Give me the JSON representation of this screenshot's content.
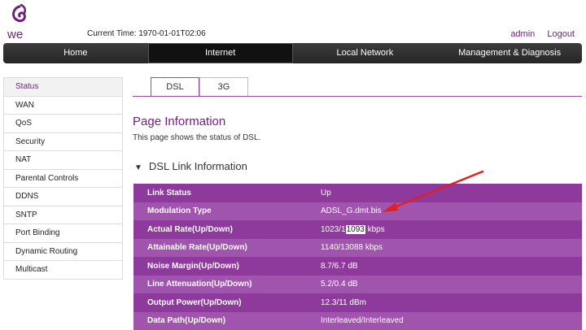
{
  "brand": {
    "logo_text": "we",
    "logo_color": "#6b1f7b"
  },
  "header": {
    "current_time_label": "Current Time:",
    "current_time_value": "1970-01-01T02:06",
    "user_link": "admin",
    "logout_link": "Logout"
  },
  "nav": {
    "items": [
      {
        "label": "Home"
      },
      {
        "label": "Internet"
      },
      {
        "label": "Local Network"
      },
      {
        "label": "Management & Diagnosis"
      }
    ],
    "active": "Internet"
  },
  "sidebar": {
    "items": [
      {
        "label": "Status"
      },
      {
        "label": "WAN"
      },
      {
        "label": "QoS"
      },
      {
        "label": "Security"
      },
      {
        "label": "NAT"
      },
      {
        "label": "Parental Controls"
      },
      {
        "label": "DDNS"
      },
      {
        "label": "SNTP"
      },
      {
        "label": "Port Binding"
      },
      {
        "label": "Dynamic Routing"
      },
      {
        "label": "Multicast"
      }
    ],
    "active": "Status"
  },
  "tabs": [
    {
      "label": "DSL"
    },
    {
      "label": "3G"
    }
  ],
  "page": {
    "title": "Page Information",
    "description": "This page shows the status of DSL."
  },
  "section": {
    "title": "DSL Link Information"
  },
  "table": {
    "rows": [
      {
        "label": "Link Status",
        "value": "Up"
      },
      {
        "label": "Modulation Type",
        "value": "ADSL_G.dmt.bis"
      },
      {
        "label": "Actual Rate(Up/Down)",
        "value_pre": "1023/1",
        "value_sel": "1093",
        "value_post": " kbps"
      },
      {
        "label": "Attainable Rate(Up/Down)",
        "value": "1140/13088 kbps"
      },
      {
        "label": "Noise Margin(Up/Down)",
        "value": "8.7/6.7 dB"
      },
      {
        "label": "Line Attenuation(Up/Down)",
        "value": "5.2/0.4 dB"
      },
      {
        "label": "Output Power(Up/Down)",
        "value": "12.3/11 dBm"
      },
      {
        "label": "Data Path(Up/Down)",
        "value": "Interleaved/Interleaved"
      }
    ]
  },
  "colors": {
    "accent": "#6b1f7b",
    "row_dark": "#8e3a9c",
    "row_light": "#a054ae",
    "annotation_arrow": "#e02020"
  }
}
